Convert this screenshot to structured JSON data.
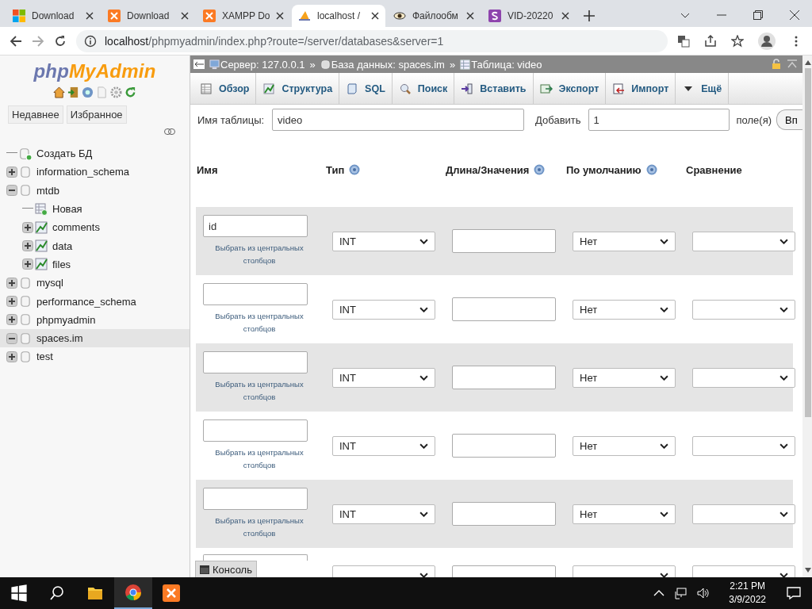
{
  "browser": {
    "tabs": [
      {
        "title": "Download",
        "kind": "windows",
        "selected": false
      },
      {
        "title": "Download",
        "kind": "xampp",
        "selected": false
      },
      {
        "title": "XAMPP Do",
        "kind": "xampp",
        "selected": false
      },
      {
        "title": "localhost /",
        "kind": "pma",
        "selected": true
      },
      {
        "title": "Файлообм",
        "kind": "eye",
        "selected": false
      },
      {
        "title": "VID-20220",
        "kind": "letter",
        "selected": false
      }
    ],
    "url_host": "localhost",
    "url_path": "/phpmyadmin/index.php?route=/server/databases&server=1"
  },
  "sidebar": {
    "logo": {
      "first": "php",
      "second": "MyAdmin"
    },
    "buttons": [
      "Недавнее",
      "Избранное"
    ],
    "tree": [
      {
        "label": "Создать БД",
        "kind": "new",
        "selected": false
      },
      {
        "label": "information_schema",
        "kind": "db",
        "expanded": false,
        "selected": false
      },
      {
        "label": "mtdb",
        "kind": "db",
        "expanded": true,
        "selected": false,
        "children": [
          {
            "label": "Новая",
            "kind": "new-table",
            "selected": false
          },
          {
            "label": "comments",
            "kind": "table",
            "expanded": false,
            "selected": false
          },
          {
            "label": "data",
            "kind": "table",
            "expanded": false,
            "selected": false
          },
          {
            "label": "files",
            "kind": "table",
            "expanded": false,
            "selected": false
          }
        ]
      },
      {
        "label": "mysql",
        "kind": "db",
        "expanded": false,
        "selected": false
      },
      {
        "label": "performance_schema",
        "kind": "db",
        "expanded": false,
        "selected": false
      },
      {
        "label": "phpmyadmin",
        "kind": "db",
        "expanded": false,
        "selected": false
      },
      {
        "label": "spaces.im",
        "kind": "db",
        "expanded": true,
        "selected": true
      },
      {
        "label": "test",
        "kind": "db",
        "expanded": false,
        "selected": false
      }
    ]
  },
  "breadcrumb": [
    {
      "label": "Сервер: 127.0.0.1",
      "kind": "server"
    },
    {
      "separator": "»",
      "label": "База данных: spaces.im",
      "kind": "database"
    },
    {
      "separator": "»",
      "label": "Таблица: video",
      "kind": "table"
    }
  ],
  "menu": [
    {
      "label": "Обзор",
      "kind": "browse"
    },
    {
      "label": "Структура",
      "kind": "structure"
    },
    {
      "label": "SQL",
      "kind": "sql"
    },
    {
      "label": "Поиск",
      "kind": "search"
    },
    {
      "label": "Вставить",
      "kind": "insert"
    },
    {
      "label": "Экспорт",
      "kind": "export"
    },
    {
      "label": "Импорт",
      "kind": "import"
    },
    {
      "label": "Ещё",
      "kind": "more"
    }
  ],
  "form": {
    "table_name_label": "Имя таблицы:",
    "table_name": "video",
    "add_label": "Добавить",
    "add_count": "1",
    "add_unit": "поле(я)",
    "go_button": "Вп"
  },
  "columns": [
    {
      "label": "Имя",
      "help": false
    },
    {
      "label": "Тип",
      "help": true
    },
    {
      "label": "Длина/Значения",
      "help": true
    },
    {
      "label": "По умолчанию",
      "help": true
    },
    {
      "label": "Сравнение",
      "help": false
    }
  ],
  "rows": [
    {
      "name": "id",
      "hint": "Выбрать из центральных столбцов",
      "type": "INT",
      "length": "",
      "default": "Нет",
      "collation": ""
    },
    {
      "name": "",
      "hint": "Выбрать из центральных столбцов",
      "type": "INT",
      "length": "",
      "default": "Нет",
      "collation": ""
    },
    {
      "name": "",
      "hint": "Выбрать из центральных столбцов",
      "type": "INT",
      "length": "",
      "default": "Нет",
      "collation": ""
    },
    {
      "name": "",
      "hint": "Выбрать из центральных столбцов",
      "type": "INT",
      "length": "",
      "default": "Нет",
      "collation": ""
    },
    {
      "name": "",
      "hint": "Выбрать из центральных столбцов",
      "type": "INT",
      "length": "",
      "default": "Нет",
      "collation": ""
    },
    {
      "name": "",
      "length": "",
      "collation": ""
    }
  ],
  "console": "Консоль",
  "taskbar": {
    "time": "2:21 PM",
    "date": "3/9/2022"
  }
}
